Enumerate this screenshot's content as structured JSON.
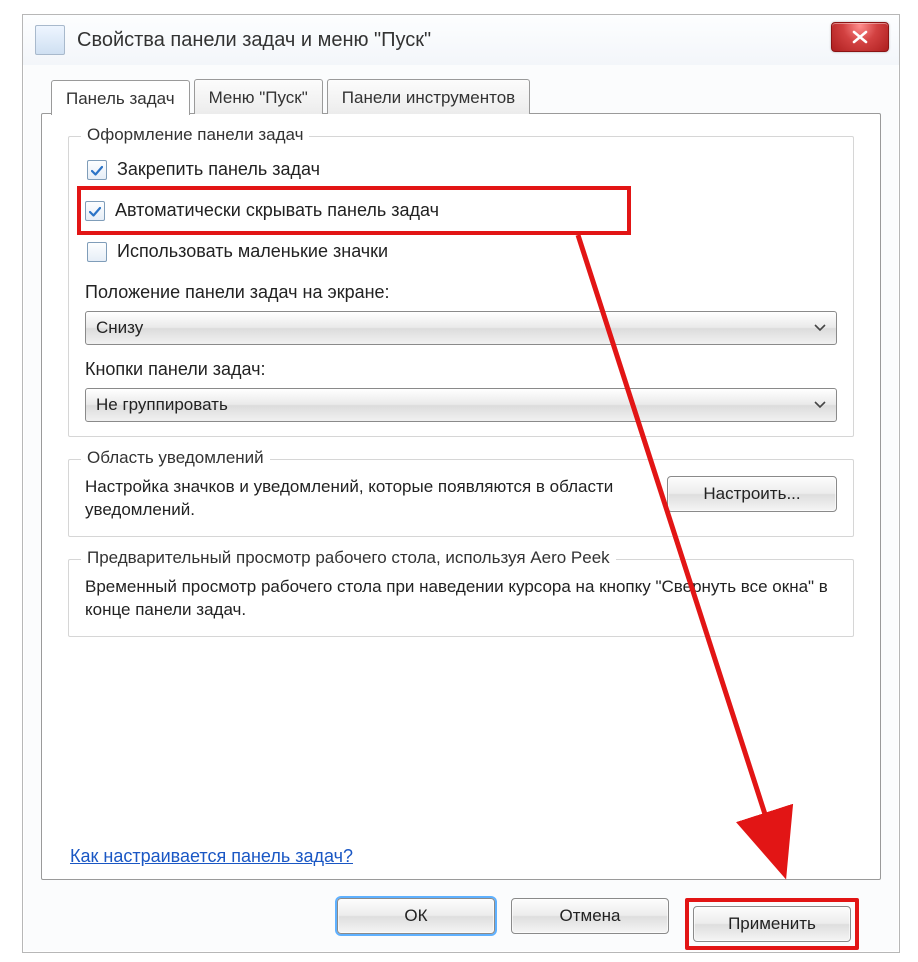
{
  "window": {
    "title": "Свойства панели задач и меню \"Пуск\""
  },
  "tabs": [
    {
      "label": "Панель задач",
      "active": true
    },
    {
      "label": "Меню \"Пуск\"",
      "active": false
    },
    {
      "label": "Панели инструментов",
      "active": false
    }
  ],
  "group_appearance": {
    "legend": "Оформление панели задач",
    "lock_label": "Закрепить панель задач",
    "lock_checked": true,
    "autohide_label": "Автоматически скрывать панель задач",
    "autohide_checked": true,
    "small_icons_label": "Использовать маленькие значки",
    "small_icons_checked": false,
    "position_label": "Положение панели задач на экране:",
    "position_value": "Снизу",
    "buttons_label": "Кнопки панели задач:",
    "buttons_value": "Не группировать"
  },
  "group_notifications": {
    "legend": "Область уведомлений",
    "text": "Настройка значков и уведомлений, которые появляются в области уведомлений.",
    "configure_label": "Настроить..."
  },
  "group_peek": {
    "legend": "Предварительный просмотр рабочего стола, используя Aero Peek",
    "text": "Временный просмотр рабочего стола при наведении курсора на кнопку \"Свернуть все окна\" в конце панели задач."
  },
  "help_link": "Как настраивается панель задач?",
  "buttons": {
    "ok": "ОК",
    "cancel": "Отмена",
    "apply": "Применить"
  }
}
